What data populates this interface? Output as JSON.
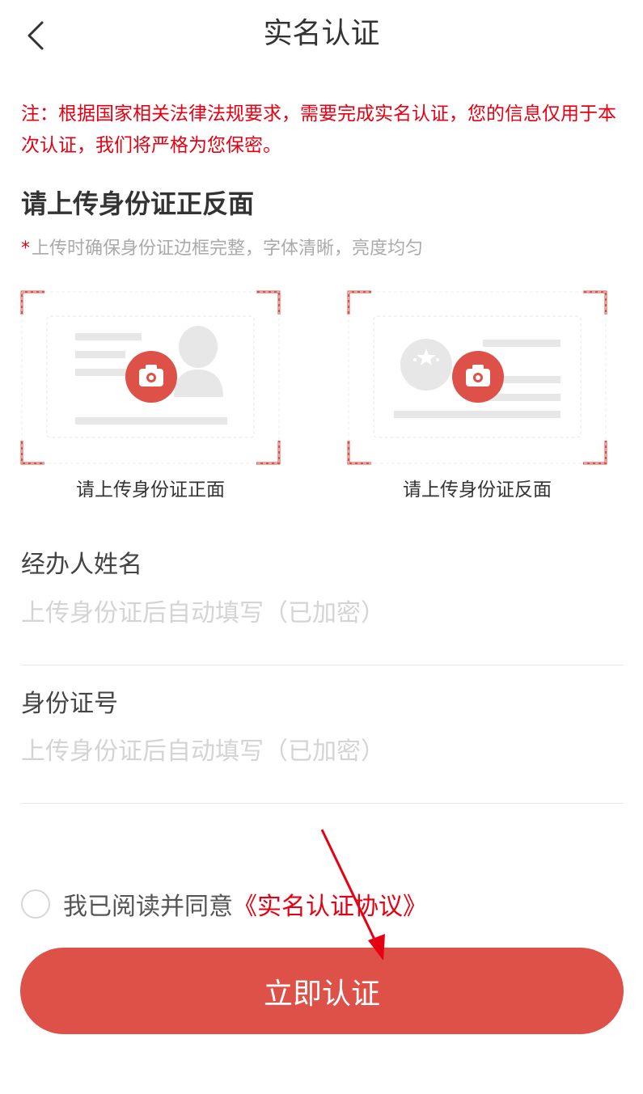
{
  "header": {
    "title": "实名认证"
  },
  "notice": "注：根据国家相关法律法规要求，需要完成实名认证，您的信息仅用于本次认证，我们将严格为您保密。",
  "upload": {
    "title": "请上传身份证正反面",
    "hint_star": "*",
    "hint": "上传时确保身份证边框完整，字体清晰，亮度均匀",
    "front_label": "请上传身份证正面",
    "back_label": "请上传身份证反面"
  },
  "fields": {
    "name_label": "经办人姓名",
    "name_placeholder": "上传身份证后自动填写（已加密）",
    "id_label": "身份证号",
    "id_placeholder": "上传身份证后自动填写（已加密）"
  },
  "agreement": {
    "text": "我已阅读并同意",
    "link": "《实名认证协议》",
    "checked": false
  },
  "submit": {
    "label": "立即认证"
  },
  "colors": {
    "accent": "#dd5148",
    "notice_red": "#e60012",
    "placeholder": "#d4d4d4"
  }
}
